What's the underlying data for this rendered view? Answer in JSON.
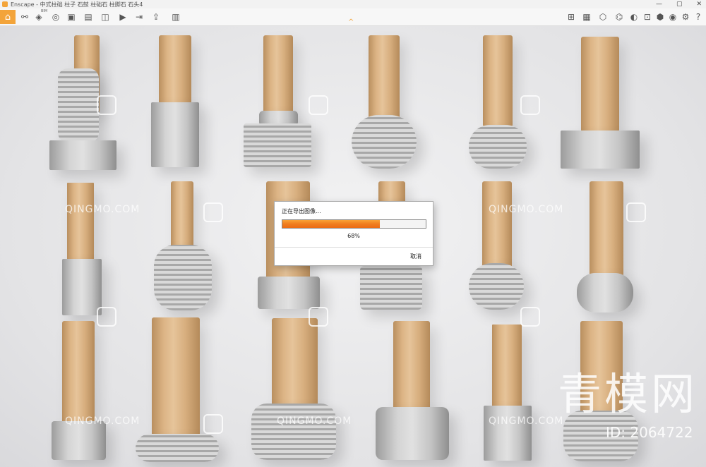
{
  "window": {
    "title": "Enscape - 中式柱础 柱子 石鼓 柱础石 柱脚石 石头4",
    "controls": [
      "—",
      "▢",
      "✕"
    ]
  },
  "toolbar": {
    "buttons": [
      {
        "name": "home",
        "glyph": "⌂"
      },
      {
        "name": "link",
        "glyph": "⚯"
      },
      {
        "name": "bim",
        "glyph": "◈",
        "caption": "BIM"
      },
      {
        "name": "vr",
        "glyph": "◎"
      },
      {
        "name": "screenshot",
        "glyph": "▣"
      },
      {
        "name": "batch",
        "glyph": "▤"
      },
      {
        "name": "panorama",
        "glyph": "◫"
      },
      {
        "name": "video",
        "glyph": "▶"
      },
      {
        "name": "export",
        "glyph": "⇥"
      },
      {
        "name": "upload",
        "glyph": "⇪"
      },
      {
        "name": "assets",
        "glyph": "▥"
      },
      {
        "name": "library",
        "glyph": "⊞"
      },
      {
        "name": "views",
        "glyph": "▦"
      },
      {
        "name": "objects",
        "glyph": "⬡"
      },
      {
        "name": "camera",
        "glyph": "⌬"
      },
      {
        "name": "material",
        "glyph": "◐"
      },
      {
        "name": "book",
        "glyph": "⊡"
      },
      {
        "name": "cube",
        "glyph": "⬢"
      },
      {
        "name": "eye",
        "glyph": "◉"
      },
      {
        "name": "settings",
        "glyph": "⚙"
      },
      {
        "name": "help",
        "glyph": "?"
      }
    ],
    "collapse_glyph": "^"
  },
  "dialog": {
    "title": "正在导出图像...",
    "progress": 0.68,
    "progress_text": "68%",
    "cancel_label": "取消"
  },
  "watermark": {
    "text": "QINGMO.COM",
    "brand": "青模网",
    "id": "ID: 2064722"
  }
}
